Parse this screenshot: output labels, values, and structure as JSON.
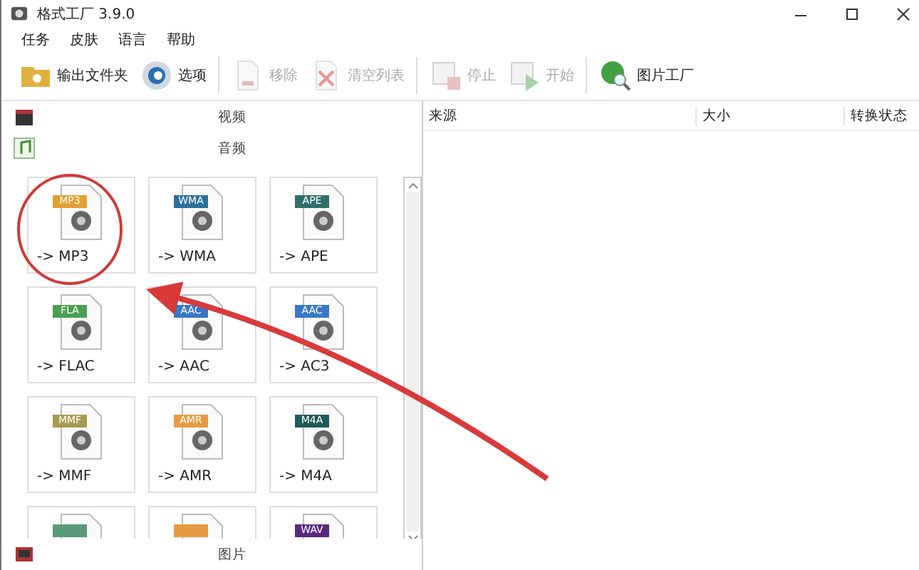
{
  "window": {
    "title": "格式工厂 3.9.0"
  },
  "menu": [
    "任务",
    "皮肤",
    "语言",
    "帮助"
  ],
  "toolbar": [
    {
      "kind": "folder",
      "label": "输出文件夹",
      "disabled": false
    },
    {
      "kind": "options",
      "label": "选项",
      "disabled": false
    },
    {
      "kind": "remove",
      "label": "移除",
      "disabled": true
    },
    {
      "kind": "clear",
      "label": "清空列表",
      "disabled": true
    },
    {
      "kind": "stop",
      "label": "停止",
      "disabled": true
    },
    {
      "kind": "start",
      "label": "开始",
      "disabled": true
    },
    {
      "kind": "picture",
      "label": "图片工厂",
      "disabled": false
    }
  ],
  "categories_top": [
    {
      "kind": "video",
      "label": "视频"
    },
    {
      "kind": "audio",
      "label": "音频"
    }
  ],
  "tiles": [
    {
      "badge": "MP3",
      "color": "#e0a030",
      "label": "-> MP3"
    },
    {
      "badge": "WMA",
      "color": "#2c6f9a",
      "label": "-> WMA"
    },
    {
      "badge": "APE",
      "color": "#2f6f6a",
      "label": "-> APE"
    },
    {
      "badge": "FLA",
      "color": "#4aa052",
      "label": "-> FLAC"
    },
    {
      "badge": "AAC",
      "color": "#3a78c8",
      "label": "-> AAC"
    },
    {
      "badge": "AAC",
      "color": "#3a78c8",
      "label": "-> AC3"
    },
    {
      "badge": "MMF",
      "color": "#a89a50",
      "label": "-> MMF"
    },
    {
      "badge": "AMR",
      "color": "#e89a40",
      "label": "-> AMR"
    },
    {
      "badge": "M4A",
      "color": "#1f5a5a",
      "label": "-> M4A"
    },
    {
      "color": "#5a9a7a"
    },
    {
      "color": "#e89a40"
    },
    {
      "badge": "WAV",
      "color": "#5a2a7a"
    }
  ],
  "categories_bottom": [
    {
      "kind": "picture",
      "label": "图片"
    }
  ],
  "table": {
    "columns": [
      "来源",
      "大小",
      "转换状态"
    ]
  },
  "annotation": {
    "circle": true,
    "arrow": true
  }
}
